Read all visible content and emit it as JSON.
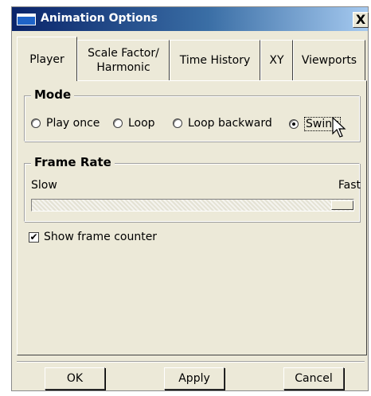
{
  "window": {
    "title": "Animation Options",
    "close_glyph": "X"
  },
  "tabs": [
    {
      "label": "Player",
      "active": true
    },
    {
      "label": "Scale Factor/\nHarmonic",
      "active": false
    },
    {
      "label": "Time History",
      "active": false
    },
    {
      "label": "XY",
      "active": false
    },
    {
      "label": "Viewports",
      "active": false
    }
  ],
  "mode": {
    "label": "Mode",
    "options": [
      {
        "label": "Play once",
        "selected": false
      },
      {
        "label": "Loop",
        "selected": false
      },
      {
        "label": "Loop backward",
        "selected": false
      },
      {
        "label": "Swing",
        "selected": true
      }
    ]
  },
  "frame_rate": {
    "label": "Frame Rate",
    "min_label": "Slow",
    "max_label": "Fast",
    "value_fraction": 1.0
  },
  "show_frame_counter": {
    "label": "Show frame counter",
    "checked": true,
    "check_glyph": "✔"
  },
  "buttons": {
    "ok": "OK",
    "apply": "Apply",
    "cancel": "Cancel"
  }
}
